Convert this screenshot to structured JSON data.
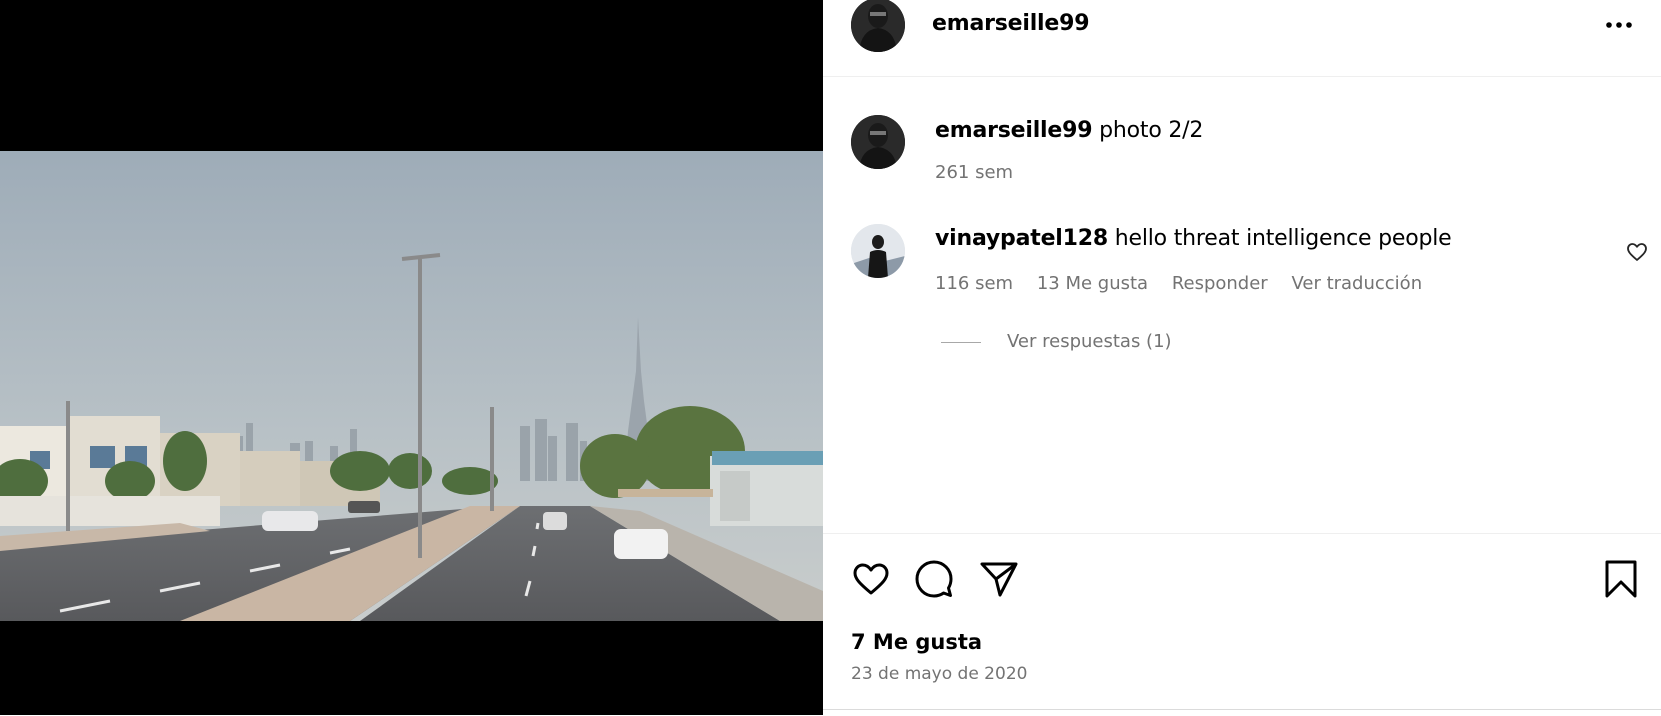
{
  "post": {
    "username": "emarseille99",
    "more_icon": "more-horizontal-icon"
  },
  "caption": {
    "username": "emarseille99",
    "text": "photo 2/2",
    "time": "261 sem"
  },
  "comment": {
    "username": "vinaypatel128",
    "text": "hello threat intelligence people",
    "time": "116 sem",
    "likes": "13 Me gusta",
    "reply_label": "Responder",
    "translate_label": "Ver traducción",
    "view_replies": "Ver respuestas (1)"
  },
  "actions": {
    "like_icon": "heart-icon",
    "comment_icon": "comment-icon",
    "share_icon": "send-icon",
    "save_icon": "bookmark-icon"
  },
  "footer": {
    "likes": "7 Me gusta",
    "date": "23 de mayo de 2020"
  }
}
